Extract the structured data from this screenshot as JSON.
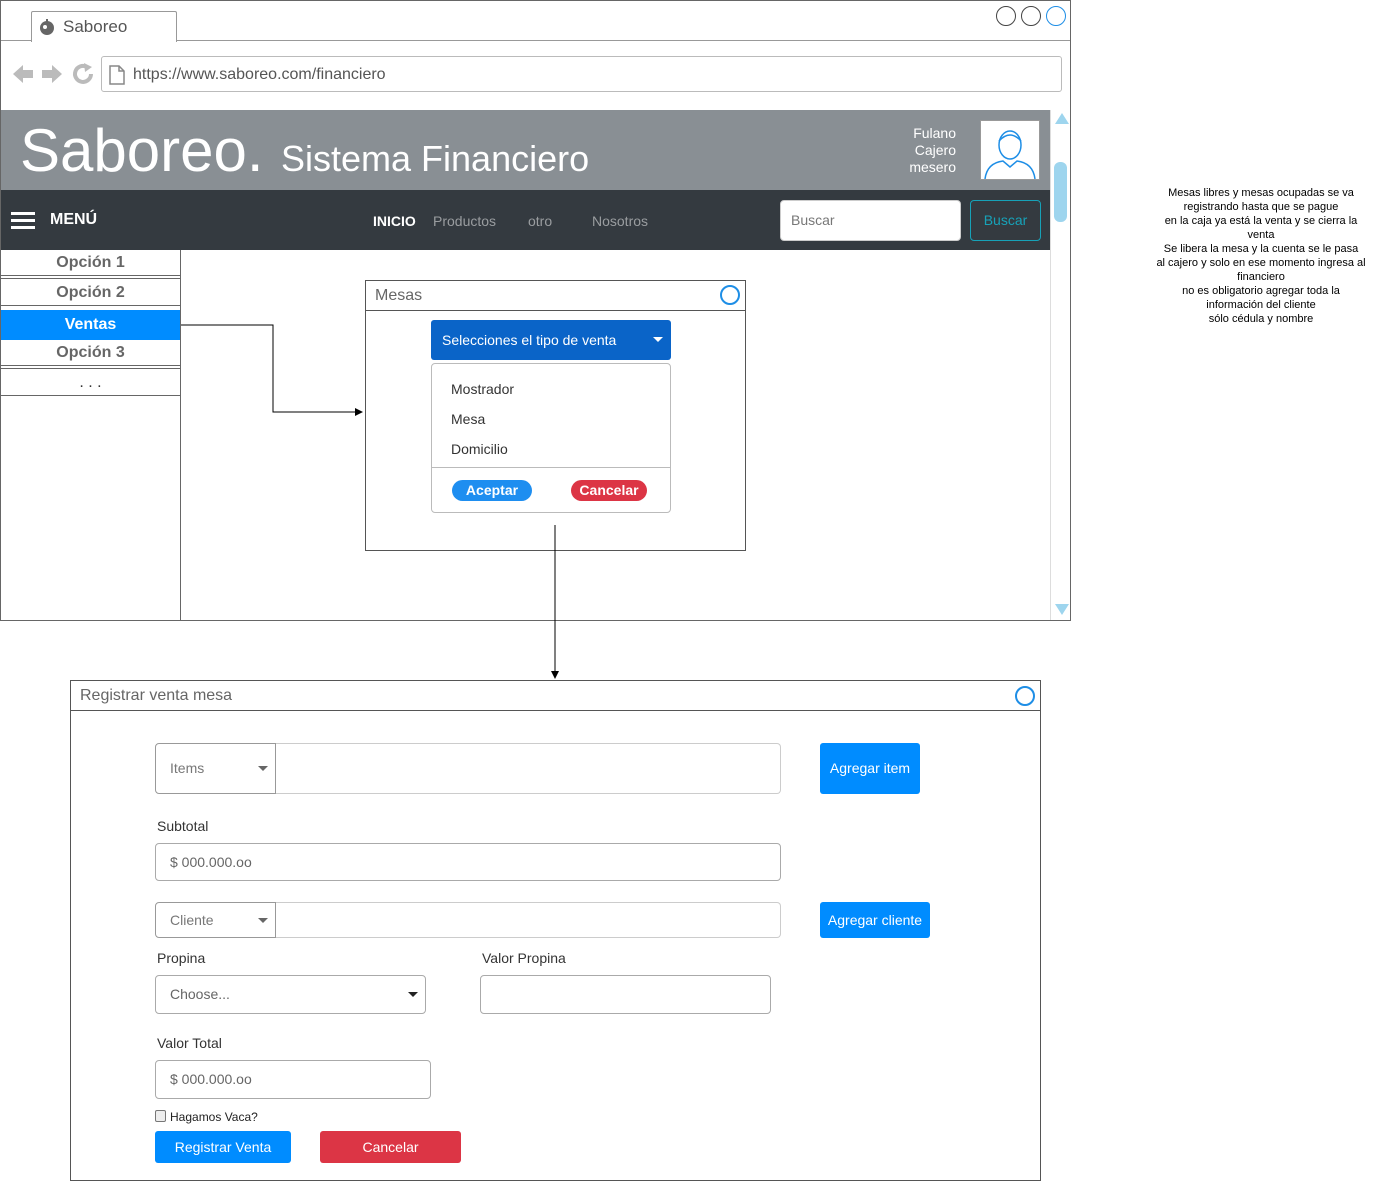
{
  "browser": {
    "tab_title": "Saboreo",
    "url": "https://www.saboreo.com/financiero"
  },
  "header": {
    "brand": "Saboreo.",
    "subtitle": "Sistema Financiero",
    "user_name": "Fulano",
    "user_role_1": "Cajero",
    "user_role_2": "mesero"
  },
  "navbar": {
    "menu_label": "MENÚ",
    "links": [
      "INICIO",
      "Productos",
      "otro",
      "Nosotros"
    ],
    "search_placeholder": "Buscar",
    "search_button": "Buscar"
  },
  "sidebar": {
    "items": [
      "Opción 1",
      "Opción 2",
      "Ventas",
      "Opción 3",
      ". . ."
    ]
  },
  "mesas_dialog": {
    "title": "Mesas",
    "dropdown_label": "Selecciones el tipo de venta",
    "options": [
      "Mostrador",
      "Mesa",
      "Domicilio"
    ],
    "accept": "Aceptar",
    "cancel": "Cancelar"
  },
  "note": "Mesas libres y mesas ocupadas se va\nregistrando hasta que se pague\nen la caja ya está la venta y se cierra la\nventa\nSe libera la mesa y la cuenta se le pasa\nal cajero y solo en ese momento ingresa al\nfinanciero\nno es obligatorio agregar toda la\ninformación del cliente\nsólo cédula y nombre",
  "registrar": {
    "title": "Registrar venta mesa",
    "items_select": "Items",
    "add_item": "Agregar item",
    "subtotal_label": "Subtotal",
    "subtotal_value": "$ 000.000.oo",
    "cliente_select": "Cliente",
    "add_cliente": "Agregar cliente",
    "propina_label": "Propina",
    "propina_select": "Choose...",
    "valor_propina_label": "Valor Propina",
    "valor_total_label": "Valor Total",
    "valor_total_value": "$ 000.000.oo",
    "vaca_label": "Hagamos Vaca?",
    "submit": "Registrar Venta",
    "cancel": "Cancelar"
  },
  "colors": {
    "header_bg": "#898f94",
    "navbar_bg": "#343a40",
    "primary": "#008cff",
    "danger": "#dc3545",
    "dropdown_bg": "#0a64c8",
    "info": "#17a2b8"
  }
}
